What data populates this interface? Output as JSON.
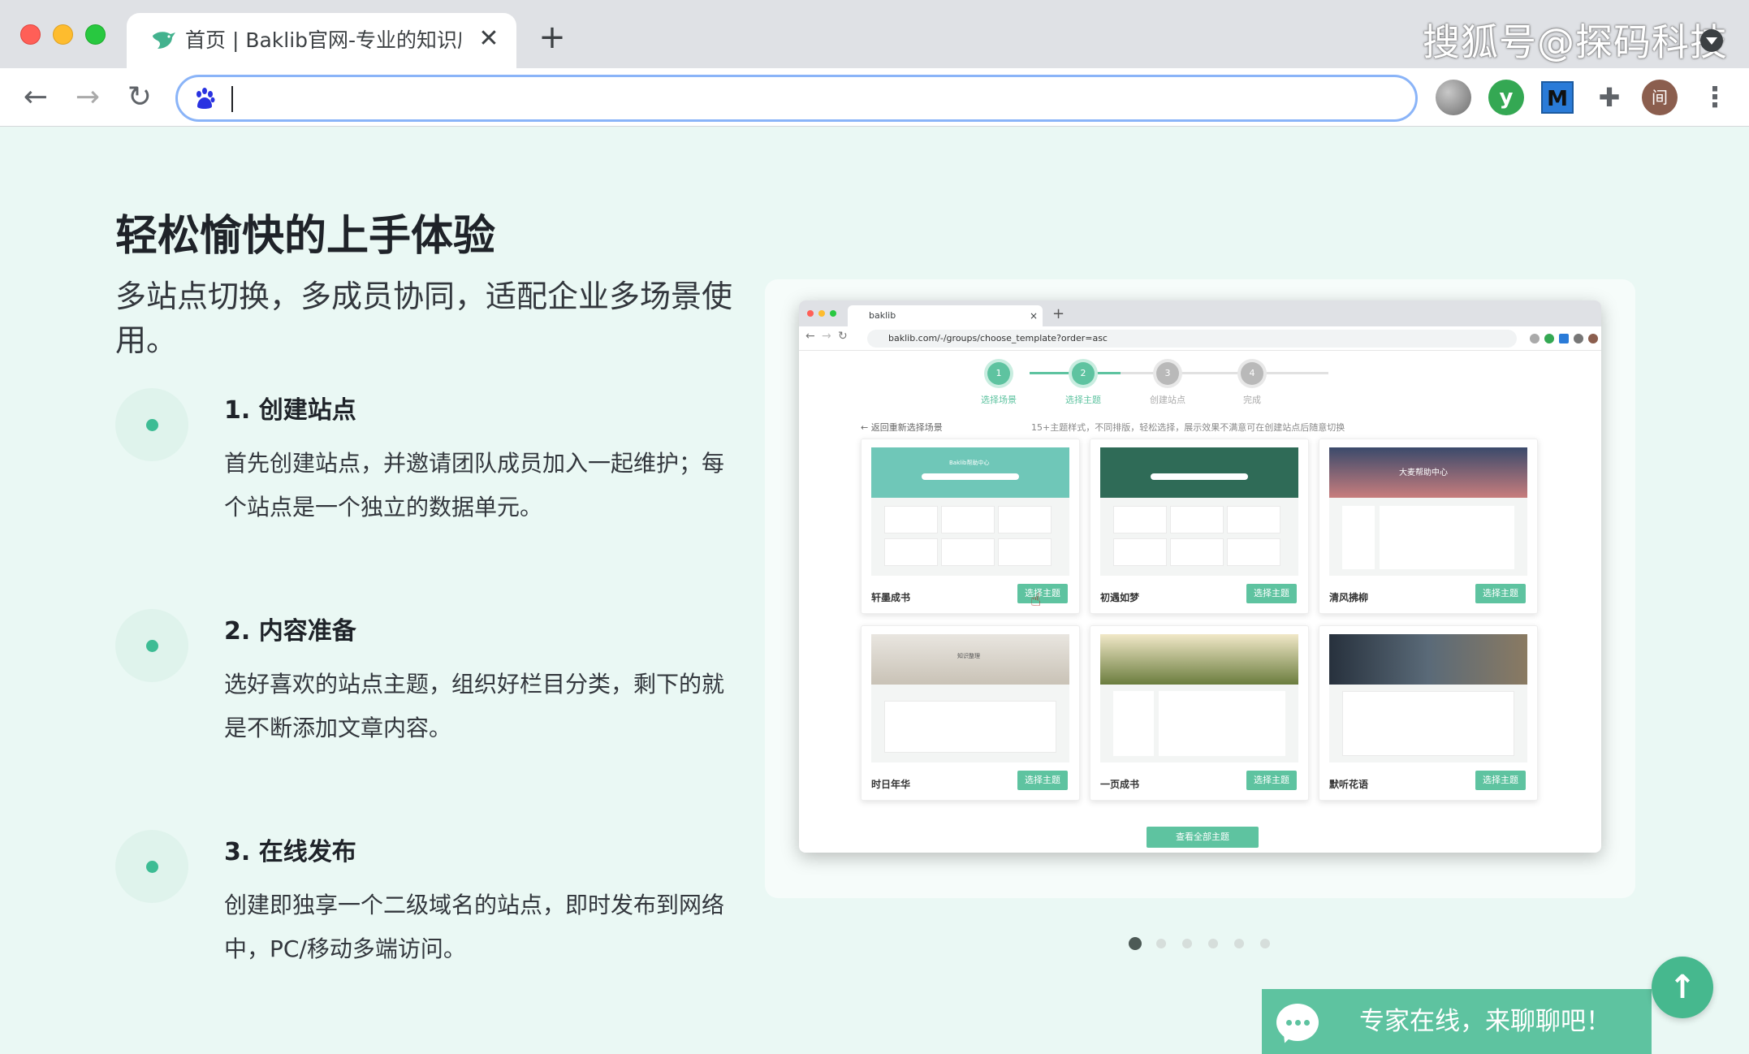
{
  "browser": {
    "tab_title": "首页 | Baklib官网-专业的知识库",
    "tab_close": "✕",
    "new_tab": "+",
    "watermark": "搜狐号@探码科技",
    "nav": {
      "back": "←",
      "forward": "→",
      "reload": "↻"
    },
    "address_value": "",
    "extensions": {
      "green": "y",
      "m": "M",
      "puzzle": "✚",
      "avatar": "间",
      "menu": "⋮"
    }
  },
  "hero": {
    "title": "轻松愉快的上手体验",
    "subtitle": "多站点切换，多成员协同，适配企业多场景使用。"
  },
  "steps": [
    {
      "title": "1. 创建站点",
      "desc": "首先创建站点，并邀请团队成员加入一起维护；每个站点是一个独立的数据单元。"
    },
    {
      "title": "2. 内容准备",
      "desc": "选好喜欢的站点主题，组织好栏目分类，剩下的就是不断添加文章内容。"
    },
    {
      "title": "3. 在线发布",
      "desc": "创建即独享一个二级域名的站点，即时发布到网络中，PC/移动多端访问。"
    }
  ],
  "screenshot": {
    "tab": "baklib",
    "tab_close": "×",
    "new_tab": "+",
    "url": "baklib.com/-/groups/choose_template?order=asc",
    "stepper": [
      {
        "num": "1",
        "label": "选择场景",
        "state": "active"
      },
      {
        "num": "2",
        "label": "选择主题",
        "state": "active"
      },
      {
        "num": "3",
        "label": "创建站点",
        "state": "inactive"
      },
      {
        "num": "4",
        "label": "完成",
        "state": "inactive"
      }
    ],
    "back_link": "← 返回重新选择场景",
    "hint": "15+主题样式，不同排版，轻松选择，展示效果不满意可在创建站点后随意切换",
    "button_label": "选择主题",
    "themes": [
      {
        "name": "轩墨成书",
        "band_color": "#6fc7b8",
        "band_text": "Baklib帮助中心"
      },
      {
        "name": "初遇如梦",
        "band_color": "#2f6b57",
        "band_text": ""
      },
      {
        "name": "清风拂柳",
        "band_color": "#3b4a6b",
        "band_text": "大麦帮助中心"
      },
      {
        "name": "时日年华",
        "band_color": "#d9d4cc",
        "band_text": "知识整理"
      },
      {
        "name": "一页成书",
        "band_color": "#9aa36a",
        "band_text": ""
      },
      {
        "name": "默听花语",
        "band_color": "#2e3b4a",
        "band_text": ""
      }
    ],
    "view_all": "查看全部主题"
  },
  "carousel": {
    "count": 6,
    "active": 1
  },
  "chat": {
    "text": "专家在线，来聊聊吧！"
  },
  "back_to_top": "↑",
  "colors": {
    "accent": "#5ec3a0",
    "page_bg": "#eaf8f4",
    "dot": "#3dbc94"
  }
}
